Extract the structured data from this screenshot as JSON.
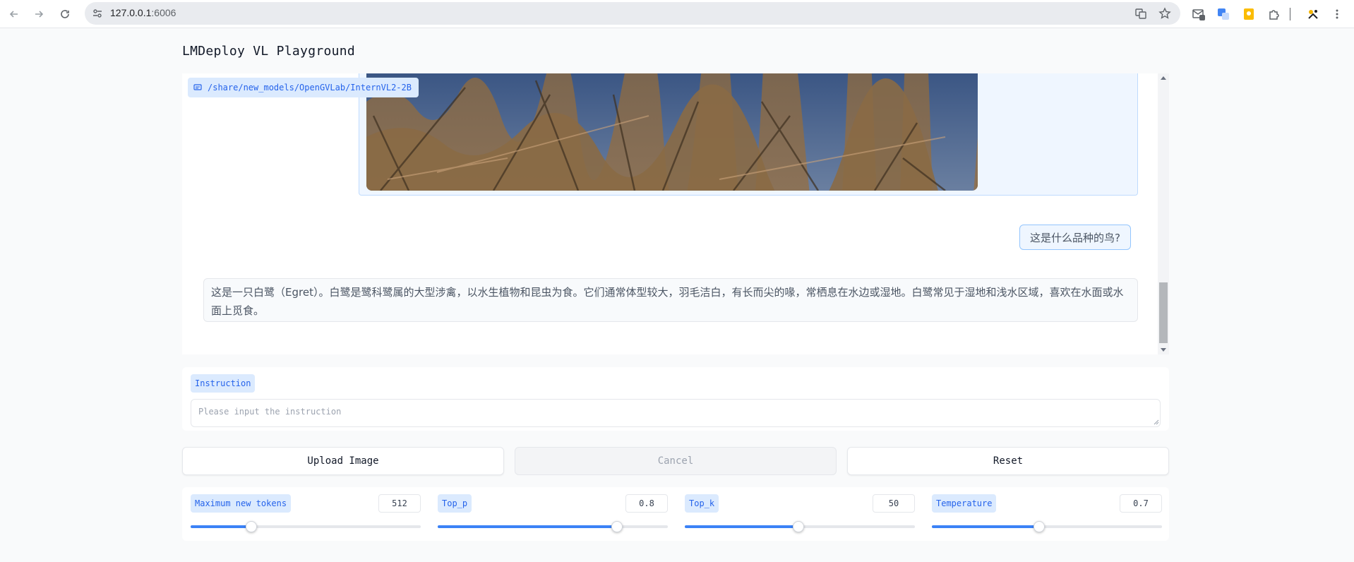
{
  "browser": {
    "url_host": "127.0.0.1",
    "url_port": ":6006"
  },
  "page": {
    "title": "LMDeploy VL Playground"
  },
  "chat": {
    "model_label": "/share/new_models/OpenGVLab/InternVL2-2B",
    "user_message": "这是什么品种的鸟?",
    "bot_message": "这是一只白鹭（Egret）。白鹭是鹭科鹭属的大型涉禽，以水生植物和昆虫为食。它们通常体型较大，羽毛洁白，有长而尖的喙，常栖息在水边或湿地。白鹭常见于湿地和浅水区域，喜欢在水面或水面上觅食。"
  },
  "instruction": {
    "label": "Instruction",
    "placeholder": "Please input the instruction",
    "value": ""
  },
  "buttons": {
    "upload": "Upload Image",
    "cancel": "Cancel",
    "reset": "Reset"
  },
  "sliders": [
    {
      "label": "Maximum new tokens",
      "value": "512",
      "fraction": 0.265
    },
    {
      "label": "Top_p",
      "value": "0.8",
      "fraction": 0.78
    },
    {
      "label": "Top_k",
      "value": "50",
      "fraction": 0.495
    },
    {
      "label": "Temperature",
      "value": "0.7",
      "fraction": 0.465
    }
  ],
  "colors": {
    "accent": "#3b82f6",
    "chip_bg": "#dbeafe",
    "chip_text": "#2563eb"
  }
}
